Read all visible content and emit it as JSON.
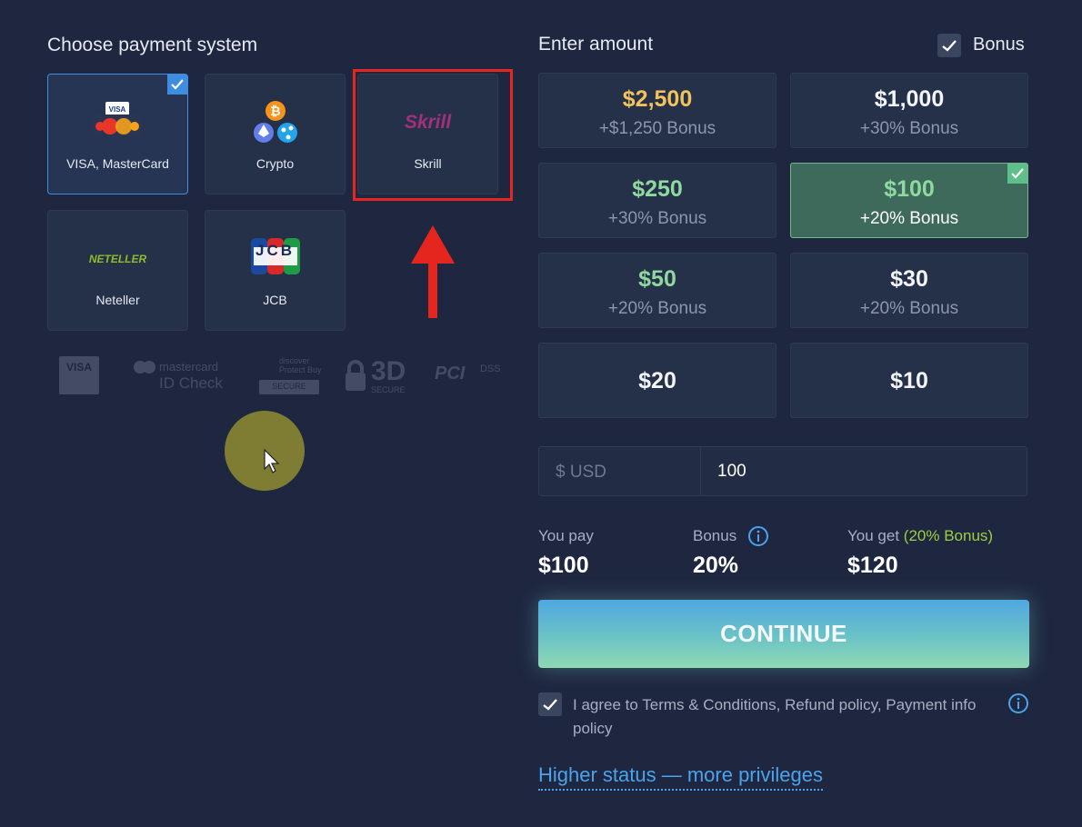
{
  "payment": {
    "title": "Choose payment system",
    "methods": [
      {
        "label": "VISA, MasterCard",
        "selected": true
      },
      {
        "label": "Crypto"
      },
      {
        "label": "Skrill",
        "logo_text": "Skrill"
      },
      {
        "label": "Neteller",
        "logo_text": "NETELLER"
      },
      {
        "label": "JCB",
        "logo_text": "JCB"
      }
    ],
    "security_logos": {
      "visa": "VISA",
      "mastercard": "mastercard",
      "id_check": "ID Check",
      "discover": "discover",
      "protect_buy": "Protect Buy",
      "secure": "SECURE",
      "three_d": "3D",
      "three_d_secure": "SECURE",
      "pci": "PCI",
      "dss": "DSS"
    }
  },
  "amount": {
    "title": "Enter amount",
    "bonus_label": "Bonus",
    "bonus_checked": true,
    "options": [
      {
        "value": "$2,500",
        "bonus": "+$1,250 Bonus",
        "color": "#f2c35b"
      },
      {
        "value": "$1,000",
        "bonus": "+30% Bonus",
        "color": "#f2f4f8"
      },
      {
        "value": "$250",
        "bonus": "+30% Bonus",
        "color": "#8fd9a0"
      },
      {
        "value": "$100",
        "bonus": "+20% Bonus",
        "color": "#8fd9a0",
        "selected": true
      },
      {
        "value": "$50",
        "bonus": "+20% Bonus",
        "color": "#8fd9a0"
      },
      {
        "value": "$30",
        "bonus": "+20% Bonus",
        "color": "#f2f4f8"
      },
      {
        "value": "$20",
        "bonus": "",
        "color": "#f2f4f8"
      },
      {
        "value": "$10",
        "bonus": "",
        "color": "#f2f4f8"
      }
    ],
    "currency_label": "$ USD",
    "input_value": "100"
  },
  "summary": {
    "you_pay_label": "You pay",
    "you_pay_value": "$100",
    "bonus_label": "Bonus",
    "bonus_value": "20%",
    "you_get_label": "You get",
    "you_get_bonus": "(20% Bonus)",
    "you_get_value": "$120"
  },
  "continue_label": "CONTINUE",
  "terms_text": "I agree to Terms & Conditions, Refund policy, Payment info policy",
  "higher_status_link": "Higher status — more privileges",
  "colors": {
    "background": "#1f2740",
    "card": "#253049",
    "accent_blue": "#3d8ee0",
    "highlight_red": "#e5261e",
    "bonus_green": "#9ccf3f"
  }
}
